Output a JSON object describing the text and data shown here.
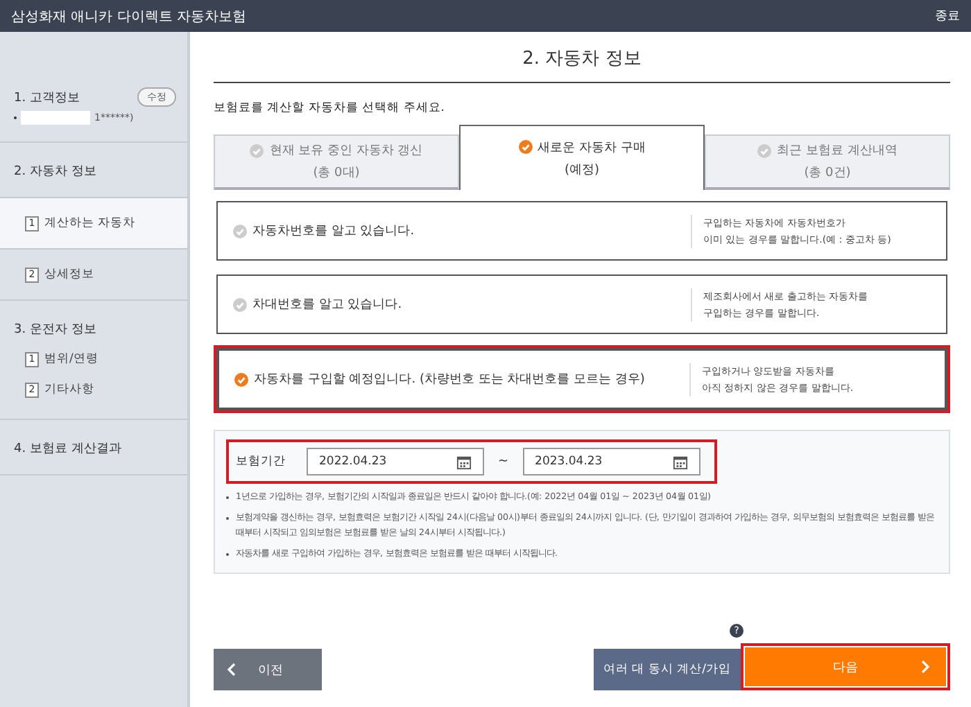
{
  "header": {
    "title": "삼성화재 애니카 다이렉트 자동차보험",
    "close": "종료"
  },
  "sidebar": {
    "sections": [
      {
        "label": "1. 고객정보",
        "edit_button": "수정",
        "detail": "1******)"
      },
      {
        "label": "2. 자동차 정보",
        "children": [
          {
            "number": "1",
            "label": "계산하는 자동차",
            "selected": true
          },
          {
            "number": "2",
            "label": "상세정보",
            "selected": false
          }
        ]
      },
      {
        "label": "3. 운전자 정보",
        "children": [
          {
            "number": "1",
            "label": "범위/연령",
            "selected": false
          },
          {
            "number": "2",
            "label": "기타사항",
            "selected": false
          }
        ]
      },
      {
        "label": "4. 보험료 계산결과"
      }
    ]
  },
  "page_title": "2. 자동차 정보",
  "instruction": "보험료를 계산할 자동차를 선택해 주세요.",
  "tabs": [
    {
      "label": "현재 보유 중인 자동차 갱신",
      "sub": "(총 0대)",
      "selected": false
    },
    {
      "label": "새로운 자동차 구매",
      "sub": "(예정)",
      "selected": true
    },
    {
      "label": "최근 보험료 계산내역",
      "sub": "(총 0건)",
      "selected": false
    }
  ],
  "options": [
    {
      "label": "자동차번호를 알고 있습니다.",
      "description": [
        "구입하는 자동차에 자동차번호가",
        "이미 있는 경우를 말합니다.(예 : 중고차 등)"
      ],
      "selected": false,
      "highlighted": false
    },
    {
      "label": "차대번호를 알고 있습니다.",
      "description": [
        "제조회사에서 새로 출고하는 자동차를",
        "구입하는 경우를 말합니다."
      ],
      "selected": false,
      "highlighted": false
    },
    {
      "label": "자동차를 구입할 예정입니다. (차량번호 또는 차대번호를 모르는 경우)",
      "description": [
        "구입하거나 양도받을 자동차를",
        "아직 정하지 않은 경우를 말합니다."
      ],
      "selected": true,
      "highlighted": true
    }
  ],
  "period": {
    "label": "보험기간",
    "start": "2022.04.23",
    "separator": "~",
    "end": "2023.04.23",
    "highlighted": true
  },
  "notes": [
    "1년으로 가입하는 경우, 보험기간의 시작일과 종료일은 반드시 같아야 합니다.(예: 2022년 04월 01일 ~ 2023년 04월 01일)",
    "보험계약을 갱신하는 경우, 보험효력은 보험기간 시작일 24시(다음날 00시)부터 종료일의 24시까지 입니다. (단, 만기일이 경과하여 가입하는 경우, 의무보험의 보험효력은 보험료를 받은 때부터 시작되고 임의보험은 보험료를 받은 날의 24시부터 시작됩니다.)",
    "자동차를 새로 구입하여 가입하는 경우, 보험효력은 보험료를 받은 때부터 시작됩니다."
  ],
  "buttons": {
    "prev": "이전",
    "multi": "여러 대 동시 계산/가입",
    "help": "?",
    "next": "다음",
    "next_highlighted": true
  }
}
